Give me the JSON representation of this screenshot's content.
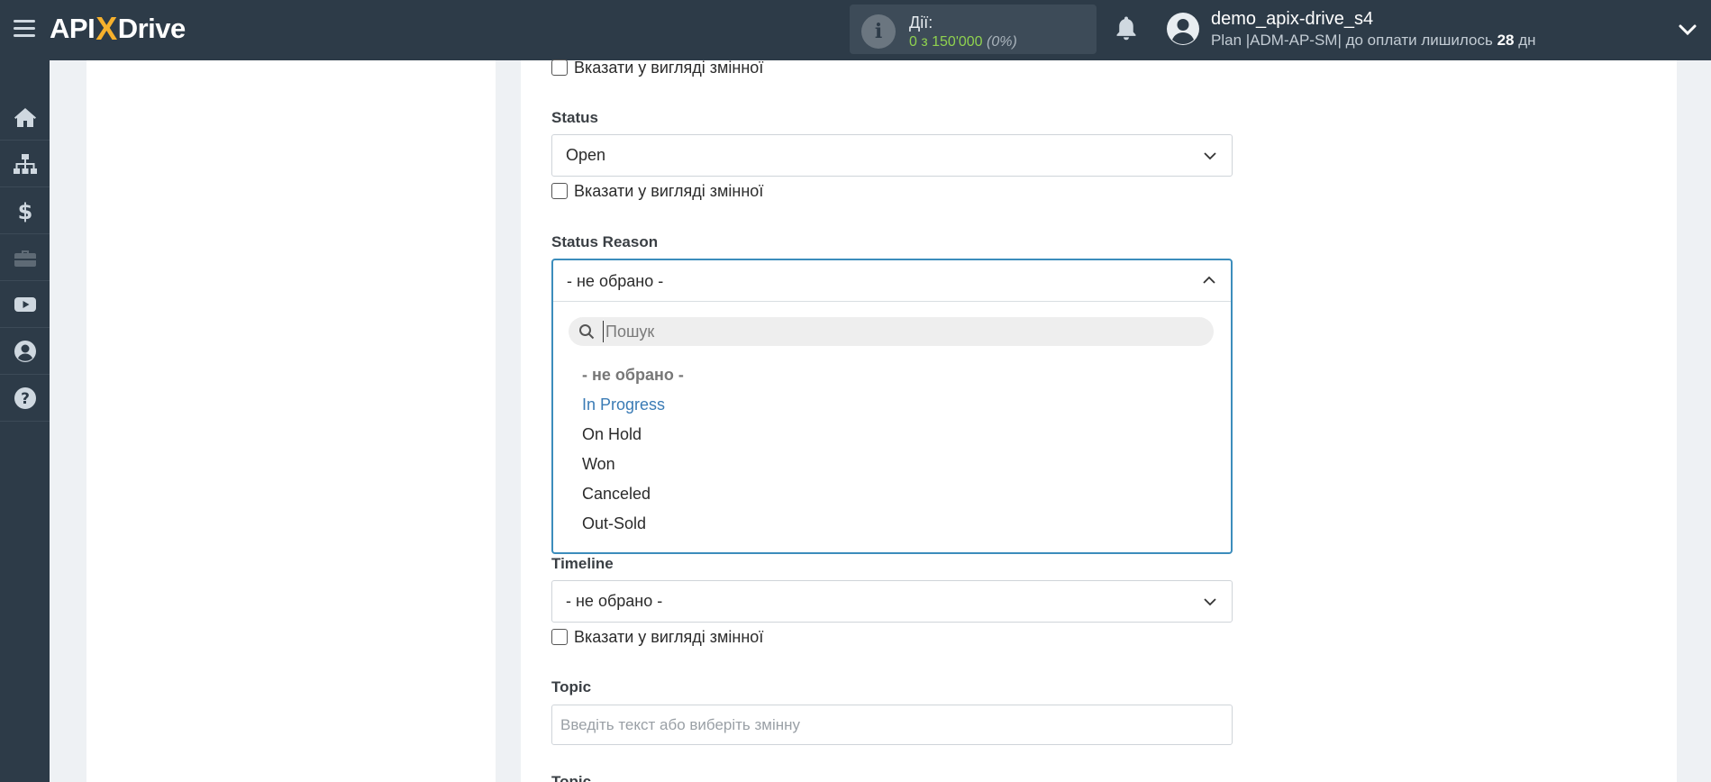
{
  "brand": {
    "part1": "API",
    "x": "X",
    "part2": "Drive"
  },
  "header": {
    "actions_label": "Дії:",
    "actions_count": "0 з 150'000",
    "actions_percent": "(0%)",
    "user_name": "demo_apix-drive_s4",
    "plan_prefix": "Plan |ADM-AP-SM| до оплати лишилось",
    "plan_days": "28",
    "plan_suffix": "дн"
  },
  "sidebar": {
    "items": [
      {
        "icon": "home-icon"
      },
      {
        "icon": "sitemap-icon"
      },
      {
        "icon": "dollar-icon"
      },
      {
        "icon": "briefcase-icon"
      },
      {
        "icon": "youtube-icon"
      },
      {
        "icon": "user-circle-icon"
      },
      {
        "icon": "question-icon"
      }
    ]
  },
  "form": {
    "checkbox_label": "Вказати у вигляді змінної",
    "status": {
      "label": "Status",
      "value": "Open"
    },
    "status_reason": {
      "label": "Status Reason",
      "value": "- не обрано -",
      "search_placeholder": "Пошук",
      "options": [
        "- не обрано -",
        "In Progress",
        "On Hold",
        "Won",
        "Canceled",
        "Out-Sold"
      ]
    },
    "timeline": {
      "label": "Timeline",
      "value": "- не обрано -"
    },
    "topic": {
      "label": "Topic",
      "placeholder": "Введіть текст або виберіть змінну"
    },
    "partial_next_label": "Topic"
  },
  "colors": {
    "topbar": "#2d3b48",
    "accent_blue": "#3a7bb5",
    "actions_green": "#8fd14f",
    "logo_x": "#f7b12c"
  }
}
